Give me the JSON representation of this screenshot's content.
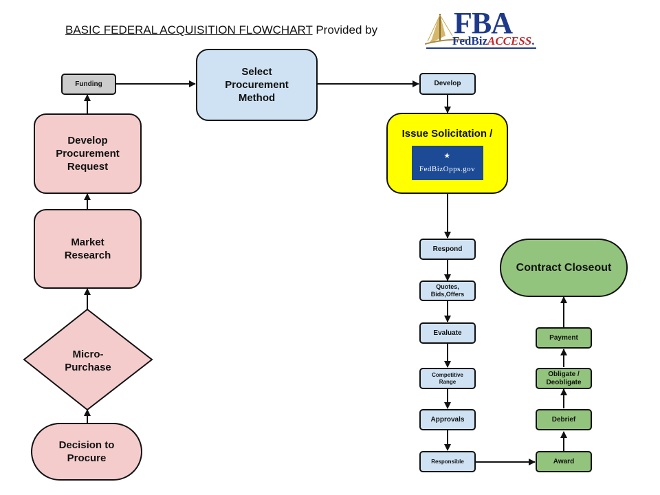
{
  "header": {
    "title_underlined": "BASIC FEDERAL ACQUISITION FLOWCHART",
    "title_suffix": " Provided by",
    "logo": {
      "mark": "FBA",
      "sub_a": "FedBiz",
      "sub_b": "ACCESS",
      "tm": ".",
      "icon": "bridge-icon"
    }
  },
  "colors": {
    "planning_pink": "#f4cccc",
    "process_blue": "#cfe2f3",
    "award_green": "#93c47d",
    "funding_gray": "#cccccc",
    "solicitation_yellow": "#ffff00",
    "fedbizopps_blue": "#1c4a94"
  },
  "nodes": {
    "funding": "Funding",
    "select_method": [
      "Select",
      "Procurement",
      "Method"
    ],
    "develop": "Develop",
    "issue_solicitation": "Issue Solicitation /",
    "fedbizopps": "★ FedBizOpps.gov",
    "develop_request": [
      "Develop",
      "Procurement",
      "Request"
    ],
    "market_research": [
      "Market",
      "Research"
    ],
    "micro_purchase": [
      "Micro-",
      "Purchase"
    ],
    "decision": [
      "Decision to",
      "Procure"
    ],
    "respond": "Respond",
    "quotes": [
      "Quotes,",
      "Bids,Offers"
    ],
    "evaluate": "Evaluate",
    "competitive_range": [
      "Competitive",
      "Range"
    ],
    "approvals": "Approvals",
    "responsible": "Responsible",
    "award": "Award",
    "debrief": "Debrief",
    "obligate": [
      "Obligate /",
      "Deobligate"
    ],
    "payment": "Payment",
    "closeout": "Contract Closeout"
  }
}
